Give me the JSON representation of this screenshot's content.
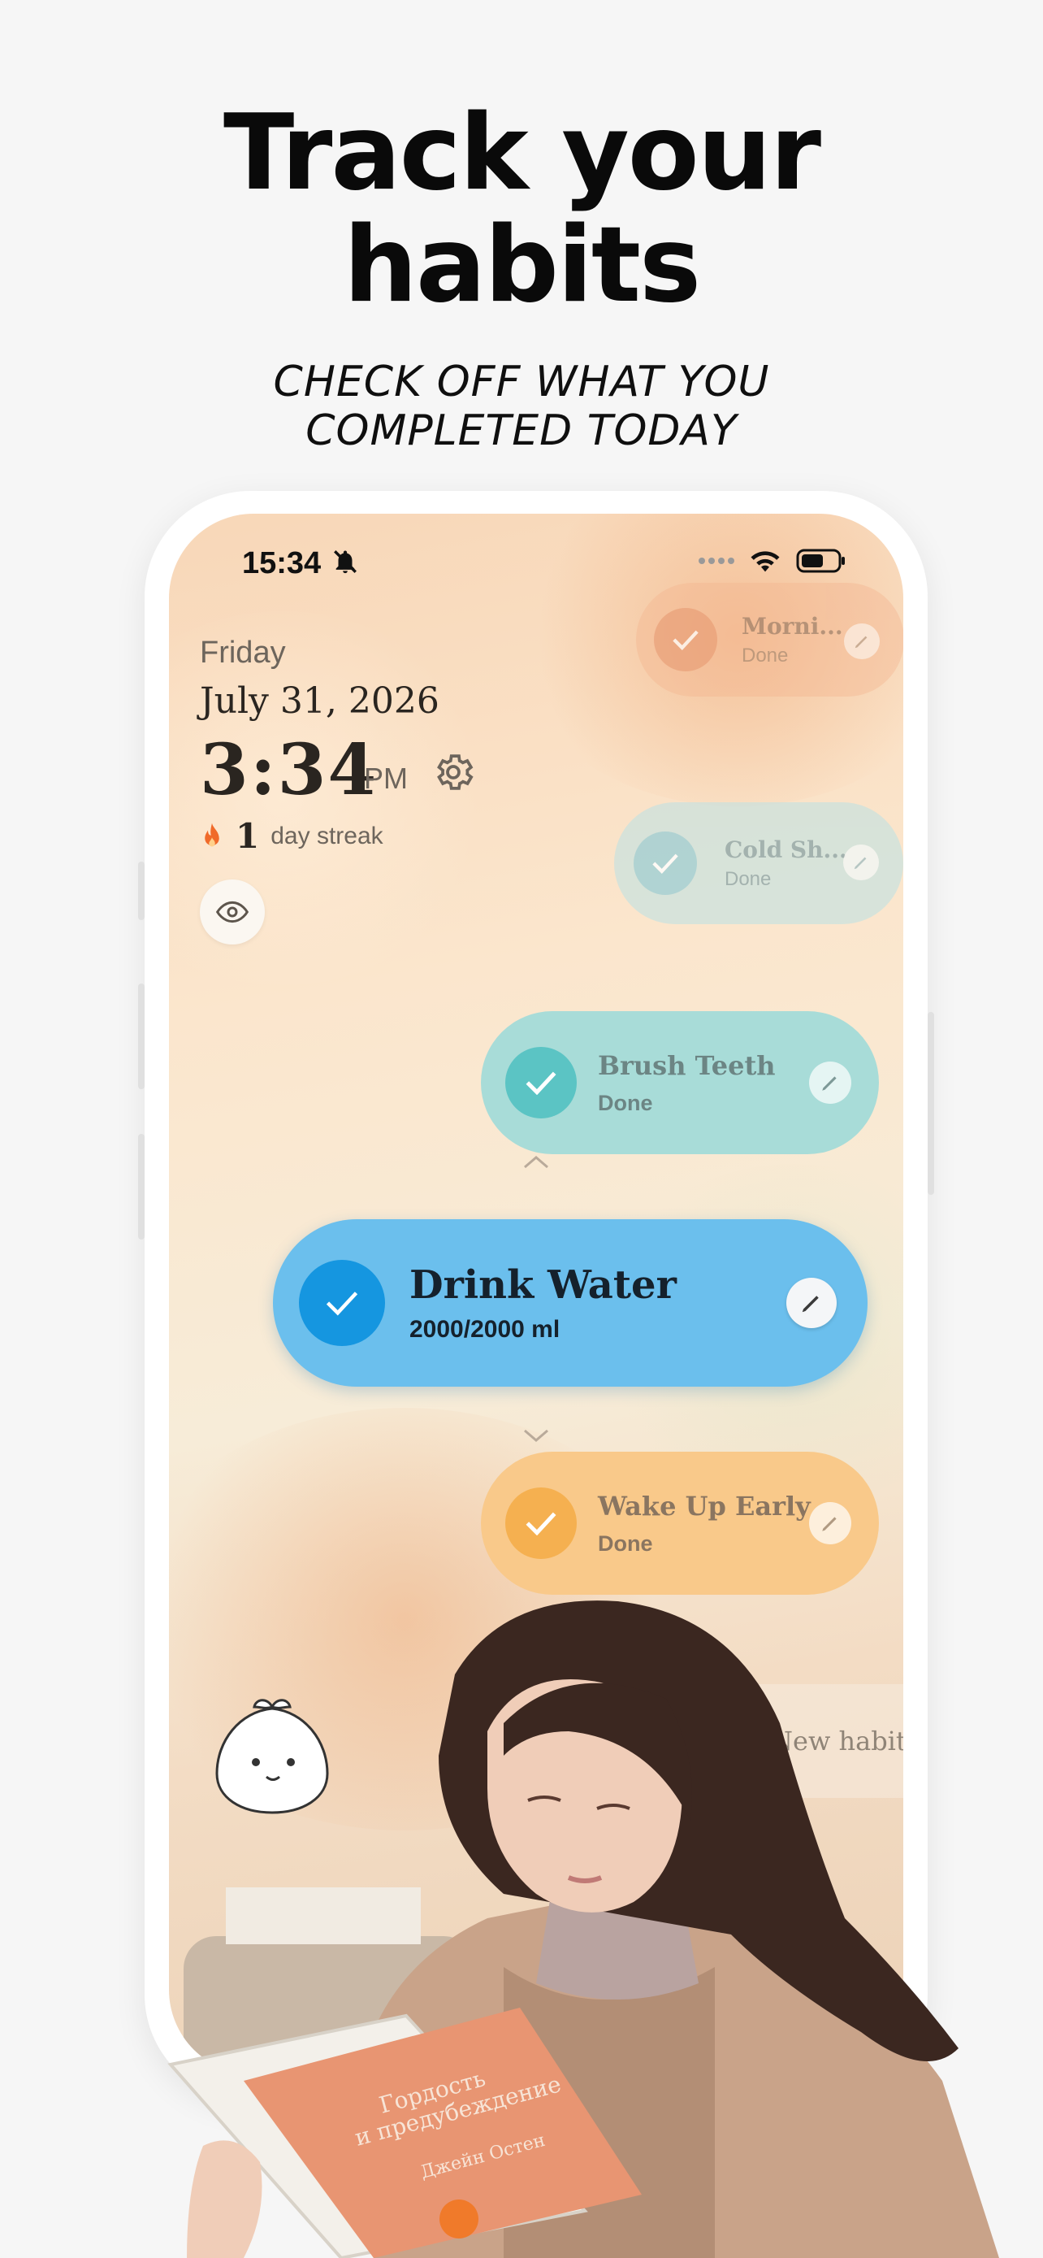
{
  "headline": {
    "line1": "Track your",
    "line2": "habits"
  },
  "subheadline": {
    "line1": "CHECK OFF WHAT YOU",
    "line2": "COMPLETED TODAY"
  },
  "status_bar": {
    "time": "15:34",
    "icons": [
      "bell-off-icon",
      "dots-icon",
      "wifi-icon",
      "battery-icon"
    ]
  },
  "header": {
    "day": "Friday",
    "date": "July 31, 2026",
    "time": "3:34",
    "ampm": "PM",
    "streak_count": "1",
    "streak_label": "day streak"
  },
  "habits": [
    {
      "name": "Morni...",
      "status": "Done",
      "color": "#f2b58e"
    },
    {
      "name": "Cold Sh...",
      "status": "Done",
      "color": "#bfe1e3"
    },
    {
      "name": "Brush Teeth",
      "status": "Done",
      "color": "#a8dcd8"
    },
    {
      "name": "Drink Water",
      "status": "2000/2000 ml",
      "color": "#6bbfed"
    },
    {
      "name": "Wake Up Early",
      "status": "Done",
      "color": "#f9c98a"
    }
  ],
  "new_habit_label": "New habit",
  "colors": {
    "accent_blue": "#1596e0",
    "teal": "#5bc4c4",
    "orange": "#f5b050",
    "flame": "#f06a2a"
  }
}
